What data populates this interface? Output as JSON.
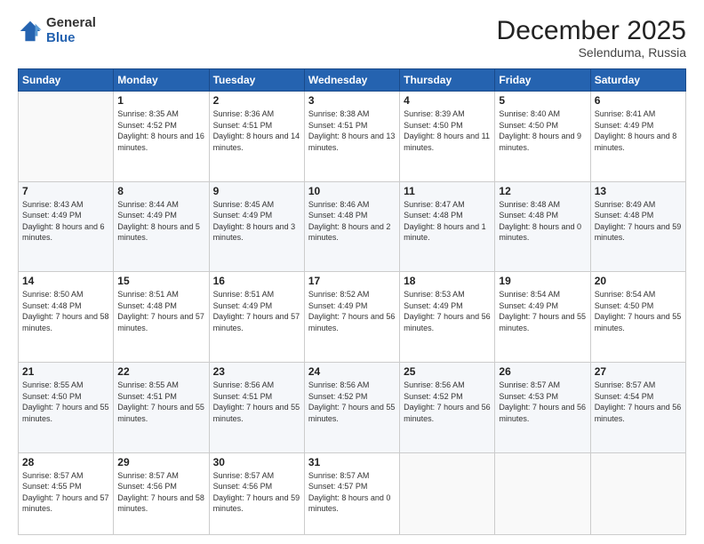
{
  "logo": {
    "general": "General",
    "blue": "Blue"
  },
  "header": {
    "month": "December 2025",
    "location": "Selenduma, Russia"
  },
  "weekdays": [
    "Sunday",
    "Monday",
    "Tuesday",
    "Wednesday",
    "Thursday",
    "Friday",
    "Saturday"
  ],
  "weeks": [
    [
      {
        "day": "",
        "sunrise": "",
        "sunset": "",
        "daylight": ""
      },
      {
        "day": "1",
        "sunrise": "8:35 AM",
        "sunset": "4:52 PM",
        "daylight": "8 hours and 16 minutes."
      },
      {
        "day": "2",
        "sunrise": "8:36 AM",
        "sunset": "4:51 PM",
        "daylight": "8 hours and 14 minutes."
      },
      {
        "day": "3",
        "sunrise": "8:38 AM",
        "sunset": "4:51 PM",
        "daylight": "8 hours and 13 minutes."
      },
      {
        "day": "4",
        "sunrise": "8:39 AM",
        "sunset": "4:50 PM",
        "daylight": "8 hours and 11 minutes."
      },
      {
        "day": "5",
        "sunrise": "8:40 AM",
        "sunset": "4:50 PM",
        "daylight": "8 hours and 9 minutes."
      },
      {
        "day": "6",
        "sunrise": "8:41 AM",
        "sunset": "4:49 PM",
        "daylight": "8 hours and 8 minutes."
      }
    ],
    [
      {
        "day": "7",
        "sunrise": "8:43 AM",
        "sunset": "4:49 PM",
        "daylight": "8 hours and 6 minutes."
      },
      {
        "day": "8",
        "sunrise": "8:44 AM",
        "sunset": "4:49 PM",
        "daylight": "8 hours and 5 minutes."
      },
      {
        "day": "9",
        "sunrise": "8:45 AM",
        "sunset": "4:49 PM",
        "daylight": "8 hours and 3 minutes."
      },
      {
        "day": "10",
        "sunrise": "8:46 AM",
        "sunset": "4:48 PM",
        "daylight": "8 hours and 2 minutes."
      },
      {
        "day": "11",
        "sunrise": "8:47 AM",
        "sunset": "4:48 PM",
        "daylight": "8 hours and 1 minute."
      },
      {
        "day": "12",
        "sunrise": "8:48 AM",
        "sunset": "4:48 PM",
        "daylight": "8 hours and 0 minutes."
      },
      {
        "day": "13",
        "sunrise": "8:49 AM",
        "sunset": "4:48 PM",
        "daylight": "7 hours and 59 minutes."
      }
    ],
    [
      {
        "day": "14",
        "sunrise": "8:50 AM",
        "sunset": "4:48 PM",
        "daylight": "7 hours and 58 minutes."
      },
      {
        "day": "15",
        "sunrise": "8:51 AM",
        "sunset": "4:48 PM",
        "daylight": "7 hours and 57 minutes."
      },
      {
        "day": "16",
        "sunrise": "8:51 AM",
        "sunset": "4:49 PM",
        "daylight": "7 hours and 57 minutes."
      },
      {
        "day": "17",
        "sunrise": "8:52 AM",
        "sunset": "4:49 PM",
        "daylight": "7 hours and 56 minutes."
      },
      {
        "day": "18",
        "sunrise": "8:53 AM",
        "sunset": "4:49 PM",
        "daylight": "7 hours and 56 minutes."
      },
      {
        "day": "19",
        "sunrise": "8:54 AM",
        "sunset": "4:49 PM",
        "daylight": "7 hours and 55 minutes."
      },
      {
        "day": "20",
        "sunrise": "8:54 AM",
        "sunset": "4:50 PM",
        "daylight": "7 hours and 55 minutes."
      }
    ],
    [
      {
        "day": "21",
        "sunrise": "8:55 AM",
        "sunset": "4:50 PM",
        "daylight": "7 hours and 55 minutes."
      },
      {
        "day": "22",
        "sunrise": "8:55 AM",
        "sunset": "4:51 PM",
        "daylight": "7 hours and 55 minutes."
      },
      {
        "day": "23",
        "sunrise": "8:56 AM",
        "sunset": "4:51 PM",
        "daylight": "7 hours and 55 minutes."
      },
      {
        "day": "24",
        "sunrise": "8:56 AM",
        "sunset": "4:52 PM",
        "daylight": "7 hours and 55 minutes."
      },
      {
        "day": "25",
        "sunrise": "8:56 AM",
        "sunset": "4:52 PM",
        "daylight": "7 hours and 56 minutes."
      },
      {
        "day": "26",
        "sunrise": "8:57 AM",
        "sunset": "4:53 PM",
        "daylight": "7 hours and 56 minutes."
      },
      {
        "day": "27",
        "sunrise": "8:57 AM",
        "sunset": "4:54 PM",
        "daylight": "7 hours and 56 minutes."
      }
    ],
    [
      {
        "day": "28",
        "sunrise": "8:57 AM",
        "sunset": "4:55 PM",
        "daylight": "7 hours and 57 minutes."
      },
      {
        "day": "29",
        "sunrise": "8:57 AM",
        "sunset": "4:56 PM",
        "daylight": "7 hours and 58 minutes."
      },
      {
        "day": "30",
        "sunrise": "8:57 AM",
        "sunset": "4:56 PM",
        "daylight": "7 hours and 59 minutes."
      },
      {
        "day": "31",
        "sunrise": "8:57 AM",
        "sunset": "4:57 PM",
        "daylight": "8 hours and 0 minutes."
      },
      {
        "day": "",
        "sunrise": "",
        "sunset": "",
        "daylight": ""
      },
      {
        "day": "",
        "sunrise": "",
        "sunset": "",
        "daylight": ""
      },
      {
        "day": "",
        "sunrise": "",
        "sunset": "",
        "daylight": ""
      }
    ]
  ]
}
